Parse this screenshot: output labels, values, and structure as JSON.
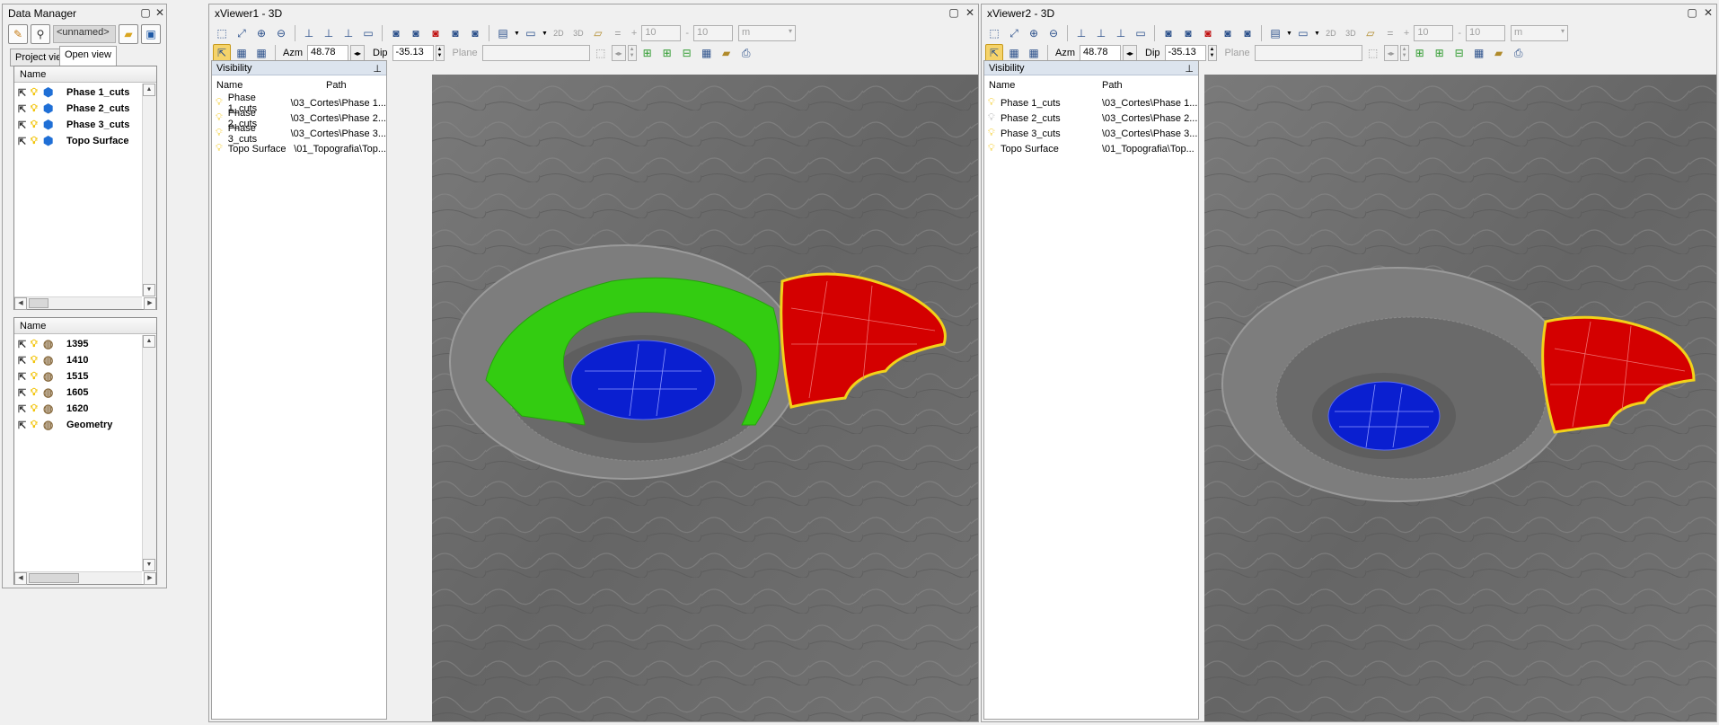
{
  "data_manager": {
    "title": "Data Manager",
    "name_field": "<unnamed>",
    "tabs": [
      "Project view",
      "Open view"
    ],
    "upper_list": {
      "header": "Name",
      "items": [
        "Phase 1_cuts",
        "Phase 2_cuts",
        "Phase 3_cuts",
        "Topo Surface"
      ]
    },
    "lower_list": {
      "header": "Name",
      "items": [
        "1395",
        "1410",
        "1515",
        "1605",
        "1620",
        "Geometry"
      ]
    }
  },
  "viewers": [
    {
      "title": "xViewer1 - 3D",
      "azm_label": "Azm",
      "azm": "48.78",
      "dip_label": "Dip",
      "dip": "-35.13",
      "plane_label": "Plane",
      "grid_a": "10",
      "grid_b": "10",
      "unit": "m",
      "visibility": {
        "title": "Visibility",
        "col_name": "Name",
        "col_path": "Path",
        "rows": [
          {
            "name": "Phase 1_cuts",
            "path": "\\03_Cortes\\Phase 1..."
          },
          {
            "name": "Phase 2_cuts",
            "path": "\\03_Cortes\\Phase 2..."
          },
          {
            "name": "Phase 3_cuts",
            "path": "\\03_Cortes\\Phase 3..."
          },
          {
            "name": "Topo Surface",
            "path": "\\01_Topografia\\Top..."
          }
        ]
      }
    },
    {
      "title": "xViewer2 - 3D",
      "azm_label": "Azm",
      "azm": "48.78",
      "dip_label": "Dip",
      "dip": "-35.13",
      "plane_label": "Plane",
      "grid_a": "10",
      "grid_b": "10",
      "unit": "m",
      "visibility": {
        "title": "Visibility",
        "col_name": "Name",
        "col_path": "Path",
        "rows": [
          {
            "name": "Phase 1_cuts",
            "path": "\\03_Cortes\\Phase 1..."
          },
          {
            "name": "Phase 2_cuts",
            "path": "\\03_Cortes\\Phase 2..."
          },
          {
            "name": "Phase 3_cuts",
            "path": "\\03_Cortes\\Phase 3..."
          },
          {
            "name": "Topo Surface",
            "path": "\\01_Topografia\\Top..."
          }
        ]
      }
    }
  ],
  "colors": {
    "phase1_green": "#33cc11",
    "phase2_red": "#d40000",
    "phase3_blue": "#0a1fd0",
    "edge_yellow": "#f2d21a",
    "terrain": "#6e6e6e",
    "active_tool": "#f5d36a"
  },
  "icons": {
    "toolbar": [
      "select-icon",
      "zoom-window-icon",
      "zoom-in-icon",
      "zoom-out-icon",
      "axis-icon",
      "axis-icon",
      "axis-icon",
      "frame-icon",
      "camera-icon",
      "camera-icon",
      "camera-add-icon",
      "camera-icon",
      "camera-icon",
      "display-icon",
      "monitor-icon",
      "2d-icon",
      "3d-icon",
      "money-icon",
      "equals-icon"
    ],
    "tree": [
      "cursor-icon",
      "bulb-icon",
      "cube-icon",
      "surface-icon"
    ]
  }
}
